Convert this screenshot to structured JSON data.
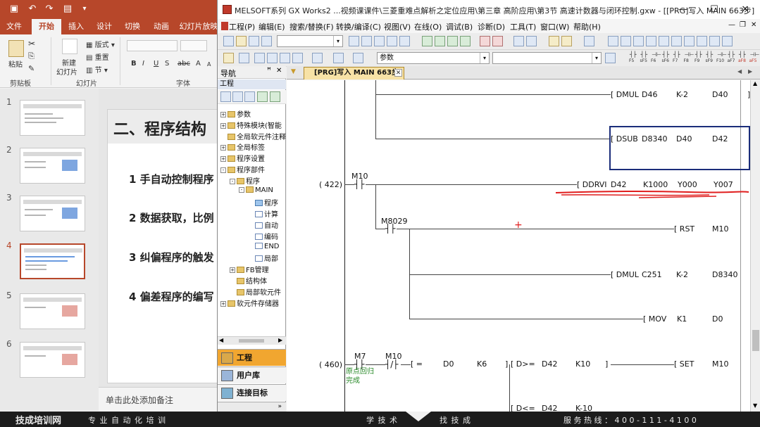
{
  "ppt": {
    "tabs": [
      "文件",
      "开始",
      "插入",
      "设计",
      "切换",
      "动画",
      "幻灯片放映"
    ],
    "active_tab": "开始",
    "clipboard": {
      "paste": "粘贴",
      "group": "剪贴板"
    },
    "slides_group": {
      "new_slide_line1": "新建",
      "new_slide_line2": "幻灯片",
      "layout": "版式",
      "reset": "重置",
      "section": "节",
      "group": "幻灯片"
    },
    "font_group": {
      "group": "字体",
      "bold": "B",
      "italic": "I",
      "underline": "U",
      "strike": "S",
      "shadow": "abc",
      "size_up": "A",
      "size_down": "A"
    },
    "thumb_numbers": [
      "1",
      "2",
      "3",
      "4",
      "5",
      "6"
    ],
    "selected_slide": "4",
    "slide": {
      "title": "二、程序结构",
      "items": [
        "1 手自动控制程序",
        "2 数据获取，比例",
        "3 纠偏程序的触发",
        "4 偏差程序的编写"
      ]
    },
    "notes_placeholder": "单击此处添加备注"
  },
  "gx": {
    "title": "MELSOFT系列 GX Works2 ...视频课课件\\三菱重难点解析之定位应用\\第三章 高阶应用\\第3节  高速计数器与闭环控制.gxw - [[PRG]写入 MAIN 663步]",
    "window_controls": {
      "minimize": "—",
      "maximize": "☐",
      "close": "✕"
    },
    "menus": [
      "工程(P)",
      "编辑(E)",
      "搜索/替换(F)",
      "转换/编译(C)",
      "视图(V)",
      "在线(O)",
      "调试(B)",
      "诊断(D)",
      "工具(T)",
      "窗口(W)",
      "帮助(H)"
    ],
    "toolbar_combo": "参数",
    "fkeys": [
      "F5",
      "sF5",
      "F6",
      "sF6",
      "F7",
      "F8",
      "F9",
      "sF9",
      "F10",
      "aF7",
      "aF8",
      "aF5",
      "caF5",
      "caF10",
      "sF7",
      "sF8",
      "aF9",
      "sF9",
      "aF10",
      "sF10"
    ],
    "nav": {
      "title": "导航",
      "pin": "ꟸ",
      "close": "✕",
      "section": "工程",
      "tree": [
        {
          "label": "参数",
          "indent": 0,
          "pm": "+"
        },
        {
          "label": "特殊模块(智能",
          "indent": 0,
          "pm": "+"
        },
        {
          "label": "全局软元件注释",
          "indent": 0,
          "pm": ""
        },
        {
          "label": "全局标签",
          "indent": 0,
          "pm": "+"
        },
        {
          "label": "程序设置",
          "indent": 0,
          "pm": "+"
        },
        {
          "label": "程序部件",
          "indent": 0,
          "pm": "-"
        },
        {
          "label": "程序",
          "indent": 1,
          "pm": "-"
        },
        {
          "label": "MAIN",
          "indent": 2,
          "pm": "-"
        },
        {
          "label": "程序",
          "indent": 3,
          "pm": ""
        },
        {
          "label": "计算",
          "indent": 3,
          "pm": ""
        },
        {
          "label": "自动",
          "indent": 3,
          "pm": ""
        },
        {
          "label": "编码",
          "indent": 3,
          "pm": ""
        },
        {
          "label": "END",
          "indent": 3,
          "pm": ""
        },
        {
          "label": "局部",
          "indent": 3,
          "pm": ""
        },
        {
          "label": "FB管理",
          "indent": 1,
          "pm": "+"
        },
        {
          "label": "结构体",
          "indent": 1,
          "pm": ""
        },
        {
          "label": "局部软元件",
          "indent": 1,
          "pm": ""
        },
        {
          "label": "软元件存储器",
          "indent": 0,
          "pm": "+"
        }
      ],
      "buttons": [
        "工程",
        "用户库",
        "连接目标"
      ],
      "active_button": "工程",
      "more": "»"
    },
    "tab": {
      "label": "[PRG]写入 MAIN 663步",
      "close": "✕"
    },
    "ladder": {
      "rows": [
        {
          "instr": "DMUL",
          "ops": [
            "D46",
            "K-2",
            "D40"
          ]
        },
        {
          "instr": "DSUB",
          "ops": [
            "D8340",
            "D40",
            "D42"
          ]
        },
        {
          "step": "( 422)",
          "contact": "M10",
          "instr": "DDRVI",
          "ops": [
            "D42",
            "K1000",
            "Y000",
            "Y007"
          ]
        },
        {
          "contact": "M8029",
          "instr": "RST",
          "ops": [
            "M10"
          ]
        },
        {
          "instr": "DMUL",
          "ops": [
            "C251",
            "K-2",
            "D8340"
          ]
        },
        {
          "instr": "MOV",
          "ops": [
            "K1",
            "D0"
          ]
        },
        {
          "step": "( 460)",
          "contact1": "M7",
          "contact2": "M10",
          "cmp": [
            "=",
            "D0",
            "K6"
          ],
          "cmp2": [
            "D>=",
            "D42",
            "K10"
          ],
          "instr": "SET",
          "ops": [
            "M10"
          ],
          "comment": [
            "原点回归",
            "完成"
          ]
        },
        {
          "cmp": [
            "D<=",
            "D42",
            "K-10"
          ]
        }
      ]
    }
  },
  "banner": {
    "logo": "技成培训网",
    "logo_sub": "www.jcpeixun.com",
    "slogan": "专 业 自 动 化 培 训",
    "left_mid": "学 技 术",
    "right_mid": "找 技 成",
    "hotline": "服 务 热 线 ： 4 0 0 - 1 1 1 - 4 1 0 0"
  },
  "colors": {
    "ppt_brand": "#b7472a",
    "nav_active": "#f1a630",
    "annotation": "#e01e1e",
    "selection": "#1b2d7a"
  }
}
